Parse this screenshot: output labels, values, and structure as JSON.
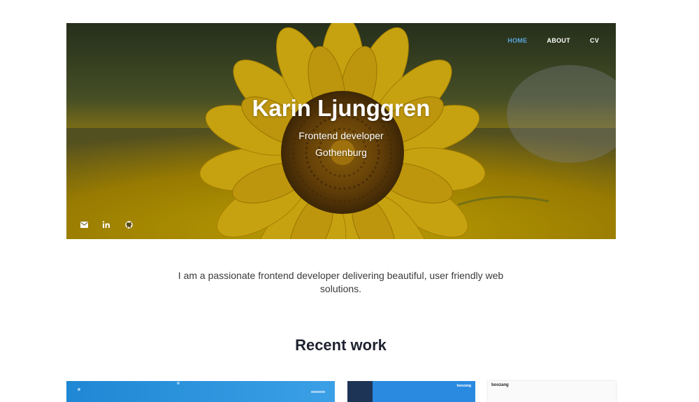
{
  "nav": {
    "items": [
      {
        "label": "HOME",
        "active": true
      },
      {
        "label": "ABOUT",
        "active": false
      },
      {
        "label": "CV",
        "active": false
      }
    ]
  },
  "hero": {
    "name": "Karin Ljunggren",
    "role": "Frontend developer",
    "location": "Gothenburg",
    "background_image": "sunflower-field"
  },
  "socials": [
    {
      "icon": "envelope-icon"
    },
    {
      "icon": "linkedin-icon"
    },
    {
      "icon": "github-icon"
    }
  ],
  "intro": "I am a passionate frontend developer delivering beautiful, user friendly web solutions.",
  "recent_work": {
    "title": "Recent work",
    "cards": [
      {
        "name": "project-card-1"
      },
      {
        "name": "project-card-2",
        "brand": "boozang"
      },
      {
        "name": "project-card-3",
        "brand": "boozang"
      }
    ]
  },
  "colors": {
    "nav_active": "#59a6e0",
    "heading": "#1f2330",
    "text": "#3a3a3a"
  }
}
